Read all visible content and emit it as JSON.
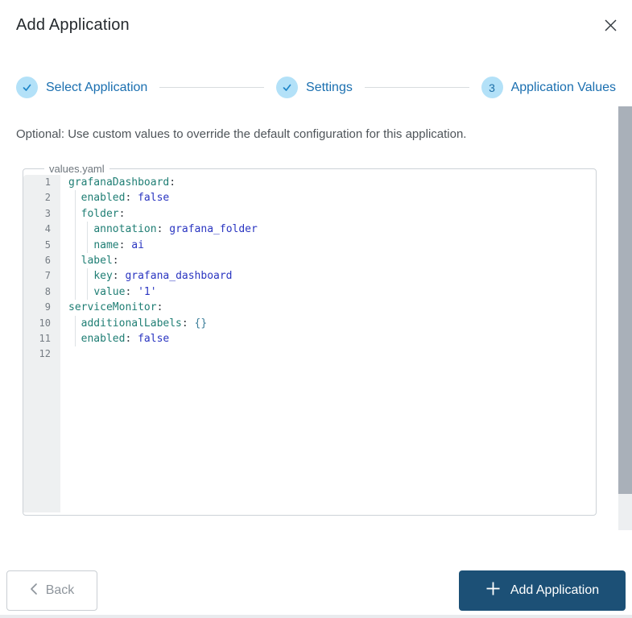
{
  "modal": {
    "title": "Add Application",
    "close_icon": "x"
  },
  "stepper": {
    "steps": [
      {
        "label": "Select Application",
        "state": "complete"
      },
      {
        "label": "Settings",
        "state": "complete"
      },
      {
        "label": "Application Values",
        "state": "current",
        "number": "3"
      }
    ]
  },
  "instruction": "Optional: Use custom values to override the default configuration for this application.",
  "editor": {
    "filename": "values.yaml",
    "lines": [
      {
        "num": 1,
        "guides": 0,
        "tokens": [
          [
            "k",
            "grafanaDashboard"
          ],
          [
            "p",
            ":"
          ]
        ]
      },
      {
        "num": 2,
        "guides": 1,
        "tokens": [
          [
            "w",
            "  "
          ],
          [
            "k",
            "enabled"
          ],
          [
            "p",
            ":"
          ],
          [
            "w",
            " "
          ],
          [
            "v",
            "false"
          ]
        ]
      },
      {
        "num": 3,
        "guides": 1,
        "tokens": [
          [
            "w",
            "  "
          ],
          [
            "k",
            "folder"
          ],
          [
            "p",
            ":"
          ]
        ]
      },
      {
        "num": 4,
        "guides": 2,
        "tokens": [
          [
            "w",
            "    "
          ],
          [
            "k",
            "annotation"
          ],
          [
            "p",
            ":"
          ],
          [
            "w",
            " "
          ],
          [
            "v",
            "grafana_folder"
          ]
        ]
      },
      {
        "num": 5,
        "guides": 2,
        "tokens": [
          [
            "w",
            "    "
          ],
          [
            "k",
            "name"
          ],
          [
            "p",
            ":"
          ],
          [
            "w",
            " "
          ],
          [
            "v",
            "ai"
          ]
        ]
      },
      {
        "num": 6,
        "guides": 1,
        "tokens": [
          [
            "w",
            "  "
          ],
          [
            "k",
            "label"
          ],
          [
            "p",
            ":"
          ]
        ]
      },
      {
        "num": 7,
        "guides": 2,
        "tokens": [
          [
            "w",
            "    "
          ],
          [
            "k",
            "key"
          ],
          [
            "p",
            ":"
          ],
          [
            "w",
            " "
          ],
          [
            "v",
            "grafana_dashboard"
          ]
        ]
      },
      {
        "num": 8,
        "guides": 2,
        "tokens": [
          [
            "w",
            "    "
          ],
          [
            "k",
            "value"
          ],
          [
            "p",
            ":"
          ],
          [
            "w",
            " "
          ],
          [
            "v",
            "'1'"
          ]
        ]
      },
      {
        "num": 9,
        "guides": 0,
        "tokens": [
          [
            "k",
            "serviceMonitor"
          ],
          [
            "p",
            ":"
          ]
        ]
      },
      {
        "num": 10,
        "guides": 1,
        "tokens": [
          [
            "w",
            "  "
          ],
          [
            "k",
            "additionalLabels"
          ],
          [
            "p",
            ":"
          ],
          [
            "w",
            " "
          ],
          [
            "b",
            "{}"
          ]
        ]
      },
      {
        "num": 11,
        "guides": 1,
        "tokens": [
          [
            "w",
            "  "
          ],
          [
            "k",
            "enabled"
          ],
          [
            "p",
            ":"
          ],
          [
            "w",
            " "
          ],
          [
            "v",
            "false"
          ]
        ]
      },
      {
        "num": 12,
        "guides": 0,
        "tokens": []
      }
    ]
  },
  "footer": {
    "back_label": "Back",
    "add_label": "Add Application"
  },
  "colors": {
    "step_circle_bg": "#b3e1f8",
    "step_accent": "#1a6fb0",
    "primary_button_bg": "#1c5076",
    "code_key": "#1f7e74",
    "code_value": "#2a35c1",
    "code_brace": "#3a7d99",
    "gutter_bg": "#eef0f1",
    "scroll_thumb": "#a9b0b9"
  }
}
